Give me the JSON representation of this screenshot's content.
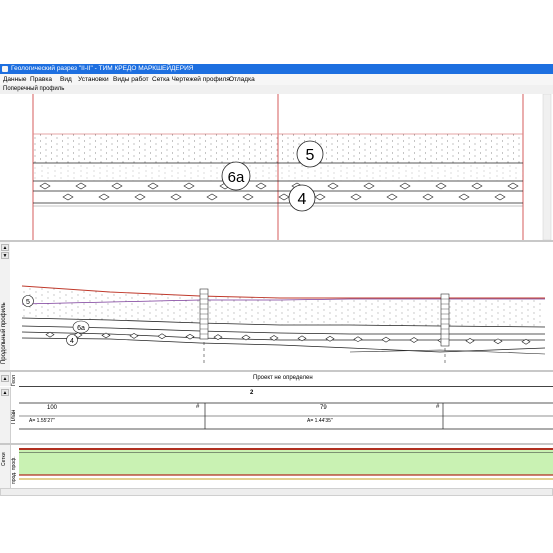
{
  "window": {
    "title": "Геологический разрез \"II-II\" - ТИМ КРЕДО МАРКШЕЙДЕРИЯ"
  },
  "menu": {
    "items": [
      "Данные",
      "Правка",
      "Вид",
      "Установки",
      "Виды работ",
      "Сетка Чертежей профиля",
      "Отладка"
    ]
  },
  "top_pane": {
    "header": "Поперечный профиль",
    "labels": {
      "layer_5": "5",
      "layer_6a": "6а",
      "layer_4": "4"
    }
  },
  "long_pane": {
    "side_title": "Продольный профиль",
    "labels": {
      "layer_5": "5",
      "layer_6a": "6а",
      "layer_4": "4"
    }
  },
  "geo_band": {
    "side_title": "Геол",
    "text": "Проект не определен"
  },
  "plan_band": {
    "side_title": "План",
    "top_number": "2",
    "cells": [
      {
        "length": "100",
        "hash": "#",
        "angle": "А= 1.55'27\""
      },
      {
        "length": "79",
        "hash": "#",
        "angle": "А= 1.44'35\""
      }
    ],
    "right_hash": "#"
  },
  "grid_band": {
    "side_title_1": "Сетки",
    "side_title_2": "прод. проф."
  },
  "colors": {
    "titlebar": "#1d6fe0",
    "boundary_lines": "#cc3333",
    "grid_fill": "#c9f2b3",
    "grid_border": "#cc0000"
  }
}
